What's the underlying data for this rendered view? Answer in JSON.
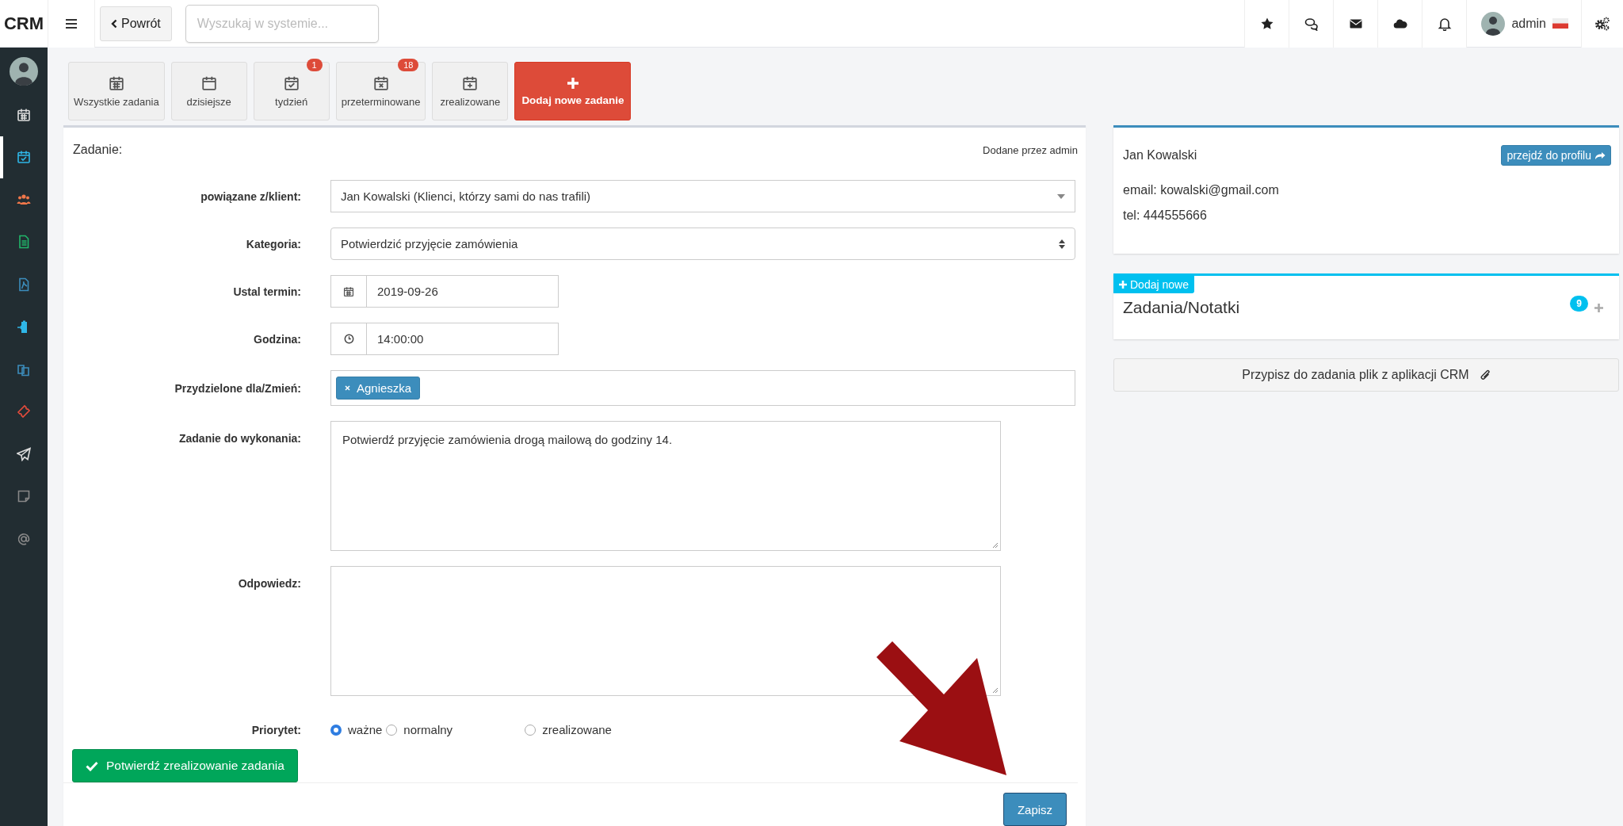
{
  "brand": "CRM",
  "back_button": "Powrót",
  "search": {
    "placeholder": "Wyszukaj w systemie..."
  },
  "user": {
    "name": "admin"
  },
  "sidebar": {
    "items": [
      {
        "selected": false
      },
      {
        "selected": true
      },
      {
        "selected": false
      },
      {
        "selected": false
      },
      {
        "selected": false
      },
      {
        "selected": false
      },
      {
        "selected": false
      },
      {
        "selected": false
      },
      {
        "selected": false
      },
      {
        "selected": false
      },
      {
        "selected": false
      }
    ]
  },
  "task_filters": [
    {
      "label": "Wszystkie zadania",
      "kind": "filter"
    },
    {
      "label": "dzisiejsze",
      "kind": "filter"
    },
    {
      "label": "tydzień",
      "kind": "filter",
      "badge": "1"
    },
    {
      "label": "przeterminowane",
      "kind": "filter",
      "badge": "18"
    },
    {
      "label": "zrealizowane",
      "kind": "filter"
    },
    {
      "label": "Dodaj nowe zadanie",
      "kind": "add"
    }
  ],
  "task": {
    "title": "Zadanie:",
    "added_by": "Dodane przez admin",
    "fields": [
      {
        "kind": "select",
        "label": "powiązane z/klient:",
        "value": "Jan Kowalski (Klienci, którzy sami do nas trafili)"
      },
      {
        "kind": "native-select",
        "label": "Kategoria:",
        "value": "Potwierdzić przyjęcie zamówienia"
      },
      {
        "kind": "date",
        "label": "Ustal termin:",
        "value": "2019-09-26"
      },
      {
        "kind": "time",
        "label": "Godzina:",
        "value": "14:00:00"
      },
      {
        "kind": "tags",
        "label": "Przydzielone dla/Zmień:",
        "tags": [
          "Agnieszka"
        ]
      },
      {
        "kind": "textarea",
        "label": "Zadanie do wykonania:",
        "value": "Potwierdź przyjęcie zamówienia drogą mailową do godziny 14."
      },
      {
        "kind": "textarea",
        "label": "Odpowiedz:"
      }
    ],
    "priority": {
      "label": "Priorytet:",
      "options": [
        {
          "label": "ważne",
          "selected": true
        },
        {
          "label": "normalny",
          "selected": false
        },
        {
          "label": "zrealizowane",
          "selected": false
        }
      ]
    },
    "complete_button": "Potwierdź zrealizowanie zadania",
    "save_button": "Zapisz"
  },
  "client": {
    "name": "Jan Kowalski",
    "profile_button": "przejdź do profilu",
    "email": "email: kowalski@gmail.com",
    "phone": "tel: 444555666"
  },
  "notes": {
    "add_button": "Dodaj nowe",
    "title": "Zadania/Notatki",
    "count": "9"
  },
  "attach_button": "Przypisz do zadania plik z aplikacji CRM"
}
